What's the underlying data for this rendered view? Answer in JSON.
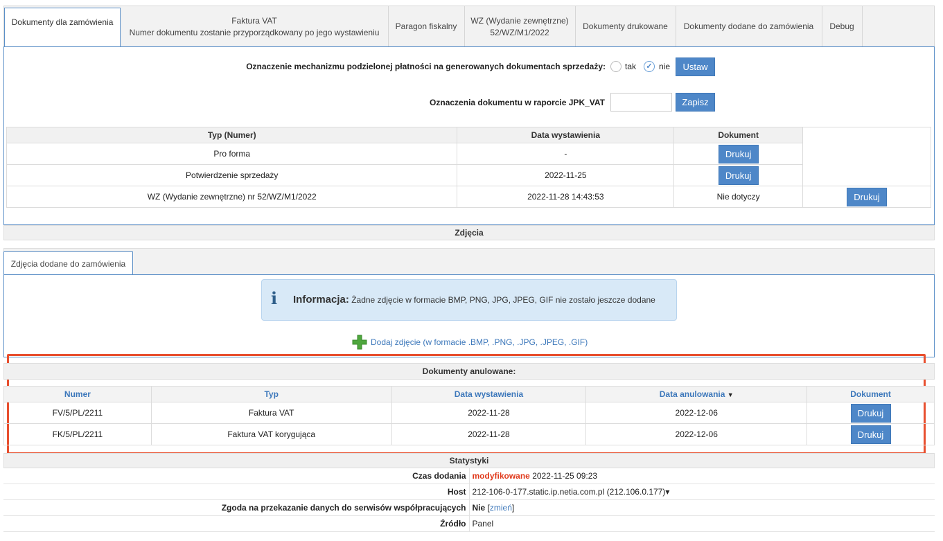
{
  "tabs": [
    {
      "label": "Dokumenty dla zamówienia"
    },
    {
      "label": "Faktura VAT",
      "sub": "Numer dokumentu zostanie przyporządkowany po jego wystawieniu"
    },
    {
      "label": "Paragon fiskalny"
    },
    {
      "label": "WZ (Wydanie zewnętrzne)",
      "sub": "52/WZ/M1/2022"
    },
    {
      "label": "Dokumenty drukowane"
    },
    {
      "label": "Dokumenty dodane do zamówienia"
    },
    {
      "label": "Debug"
    }
  ],
  "split_payment": {
    "label": "Oznaczenie mechanizmu podzielonej płatności na generowanych dokumentach sprzedaży:",
    "opt_yes": "tak",
    "opt_no": "nie",
    "button": "Ustaw"
  },
  "jpk": {
    "label": "Oznaczenia dokumentu w raporcie JPK_VAT",
    "value": "",
    "button": "Zapisz"
  },
  "docs_table": {
    "headers": [
      "Typ (Numer)",
      "Data wystawienia",
      "Dokument"
    ],
    "rows": [
      {
        "type": "Pro forma",
        "date": "-",
        "doc": "Drukuj"
      },
      {
        "type": "Potwierdzenie sprzedaży",
        "date": "2022-11-25",
        "doc": "Drukuj"
      },
      {
        "type": "WZ (Wydanie zewnętrzne) nr 52/WZ/M1/2022",
        "date": "2022-11-28 14:43:53",
        "doc": "Nie dotyczy",
        "extra": "Drukuj"
      }
    ]
  },
  "photos": {
    "section_title": "Zdjęcia",
    "tab": "Zdjęcia dodane do zamówienia",
    "info_title": "Informacja:",
    "info_text": "Żadne zdjęcie w formacie BMP, PNG, JPG, JPEG, GIF nie zostało jeszcze dodane",
    "add_link": "Dodaj zdjęcie (w formacie .BMP, .PNG, .JPG, .JPEG, .GIF)"
  },
  "cancelled": {
    "title": "Dokumenty anulowane:",
    "headers": [
      "Numer",
      "Typ",
      "Data wystawienia",
      "Data anulowania",
      "Dokument"
    ],
    "rows": [
      {
        "number": "FV/5/PL/2211",
        "type": "Faktura VAT",
        "issued": "2022-11-28",
        "cancelled": "2022-12-06",
        "doc": "Drukuj"
      },
      {
        "number": "FK/5/PL/2211",
        "type": "Faktura VAT korygująca",
        "issued": "2022-11-28",
        "cancelled": "2022-12-06",
        "doc": "Drukuj"
      }
    ],
    "highlight_color": "#e8502f"
  },
  "stats": {
    "title": "Statystyki",
    "rows": [
      {
        "key": "Czas dodania",
        "flag": "modyfikowane",
        "value": "2022-11-25 09:23"
      },
      {
        "key": "Host",
        "value": "212-106-0-177.static.ip.netia.com.pl (212.106.0.177)▾"
      },
      {
        "key": "Zgoda na przekazanie danych do serwisów współpracujących",
        "value": "Nie",
        "link": "zmień"
      },
      {
        "key": "Źródło",
        "value": "Panel"
      }
    ]
  },
  "colors": {
    "accent": "#4e87c8",
    "highlight": "#e8502f",
    "flag": "#e03a1c"
  }
}
